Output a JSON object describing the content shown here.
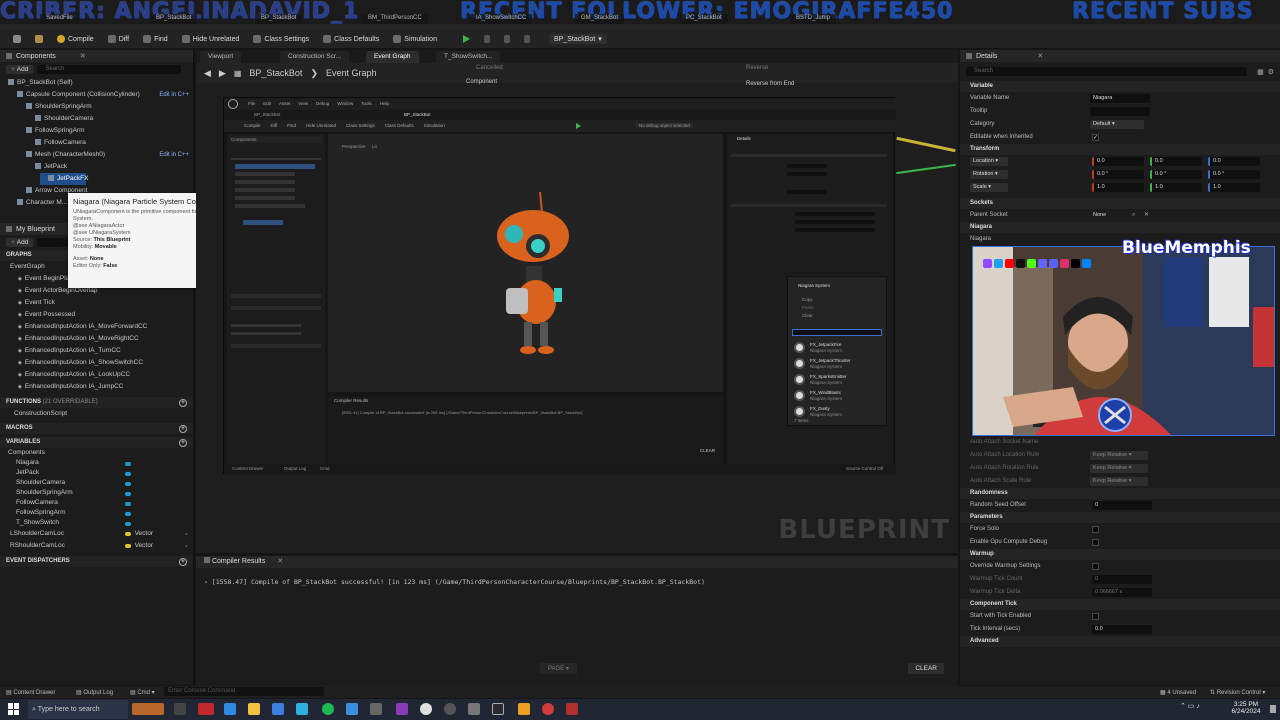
{
  "banner": {
    "left": "CRIBER: ANGELINADAVID_1",
    "middle": "RECENT FOLLOWER: EMOGIRAFFE450",
    "right": "RECENT SUBS"
  },
  "file_tabs": [
    "SavedFile",
    "BP_StackBot",
    "BP_StackBot",
    "BM_ThirdPersonCC",
    "IA_ShowSwitchCC",
    "GM_StackBot",
    "PC_StackBot",
    "BSTD_Jump"
  ],
  "toolbar": {
    "compile": "Compile",
    "diff": "Diff",
    "find": "Find",
    "hide_unrelated": "Hide Unrelated",
    "class_settings": "Class Settings",
    "class_defaults": "Class Defaults",
    "simulation": "Simulation",
    "debug_object": "BP_StackBot"
  },
  "components": {
    "title": "Components",
    "add": "Add",
    "search_placeholder": "Search",
    "items": [
      {
        "label": "BP_StackBot (Self)",
        "indent": 0
      },
      {
        "label": "Capsule Component (CollisionCylinder)",
        "indent": 1,
        "edit": "Edit in C++"
      },
      {
        "label": "ShoulderSpringArm",
        "indent": 2
      },
      {
        "label": "ShoulderCamera",
        "indent": 3
      },
      {
        "label": "FollowSpringArm",
        "indent": 2
      },
      {
        "label": "FollowCamera",
        "indent": 3
      },
      {
        "label": "Mesh (CharacterMesh0)",
        "indent": 2,
        "edit": "Edit in C++"
      },
      {
        "label": "JetPack",
        "indent": 3
      },
      {
        "label": "JetPackFX",
        "indent": 4,
        "selected": true
      },
      {
        "label": "Arrow Component",
        "indent": 2
      },
      {
        "label": "Character M...",
        "indent": 1
      }
    ]
  },
  "tooltip": {
    "title": "Niagara (Niagara Particle System Component)",
    "desc1": "UNiagaraComponent is the primitive component for a Niagara",
    "desc2": "System.",
    "see1": "@see ANiagaraActor",
    "see2": "@see UNiagaraSystem",
    "source_label": "Source:",
    "source_val": "This Blueprint",
    "mobility_label": "Mobility:",
    "mobility_val": "Movable",
    "asset_label": "Asset:",
    "asset_val": "None",
    "editor_only_label": "Editor Only:",
    "editor_only_val": "False"
  },
  "my_blueprint": {
    "title": "My Blueprint",
    "add": "Add",
    "graphs_label": "GRAPHS",
    "event_graph": "EventGraph",
    "events": [
      "Event BeginPlay",
      "Event ActorBeginOverlap",
      "Event Tick",
      "Event Possessed",
      "EnhancedInputAction IA_MoveForwardCC",
      "EnhancedInputAction IA_MoveRightCC",
      "EnhancedInputAction IA_TurnCC",
      "EnhancedInputAction IA_ShowSwitchCC",
      "EnhancedInputAction IA_LookUpCC",
      "EnhancedInputAction IA_JumpCC"
    ],
    "functions_label": "FUNCTIONS",
    "functions_count": "(21 OVERRIDABLE)",
    "construction": "ConstructionScript",
    "macros_label": "MACROS",
    "variables_label": "VARIABLES",
    "components_label": "Components",
    "variables": [
      {
        "name": "Niagara",
        "type": "comp"
      },
      {
        "name": "JetPack",
        "type": "comp"
      },
      {
        "name": "ShoulderCamera",
        "type": "comp"
      },
      {
        "name": "ShoulderSpringArm",
        "type": "comp"
      },
      {
        "name": "FollowCamera",
        "type": "comp"
      },
      {
        "name": "FollowSpringArm",
        "type": "comp"
      },
      {
        "name": "T_ShowSwitch",
        "type": "comp"
      }
    ],
    "vec_vars": [
      {
        "name": "LShoulderCamLoc",
        "type": "Vector"
      },
      {
        "name": "RShoulderCamLoc",
        "type": "Vector"
      }
    ],
    "dispatchers_label": "EVENT DISPATCHERS"
  },
  "center": {
    "tabs": [
      "Viewport",
      "Construction Scr...",
      "Event Graph",
      "T_ShowSwitch..."
    ],
    "active_tab": 2,
    "breadcrumb_root": "BP_StackBot",
    "breadcrumb_leaf": "Event Graph",
    "watermark": "BLUEPRINT",
    "mini_labels": [
      "Reverse",
      "Reverse from End",
      "Component",
      "Cancelled"
    ]
  },
  "inner_editor": {
    "menu": [
      "File",
      "Edit",
      "Asset",
      "View",
      "Debug",
      "Window",
      "Tools",
      "Help"
    ],
    "tabs": [
      "BP_StackBot",
      "BP_StackBot"
    ],
    "toolbar": [
      "Compile",
      "Diff",
      "Find",
      "Hide Unrelated",
      "Class Settings",
      "Class Defaults",
      "Simulation"
    ],
    "debug_filter": "No debug object selected",
    "viewport_tabs": [
      "Components",
      "Viewport",
      "Construction Scr",
      "Event Graph"
    ],
    "perspective": "Perspective",
    "lit": "Lit",
    "details_title": "Details",
    "dropdown_header": "Niagara System",
    "dropdown_items": [
      "Copy",
      "Paste",
      "Clear"
    ],
    "assets": [
      {
        "name": "FX_JetpackFire",
        "type": "Niagara System"
      },
      {
        "name": "FX_JetpackThruster",
        "type": "Niagara System"
      },
      {
        "name": "FX_SparksEmitter",
        "type": "Niagara System"
      },
      {
        "name": "FX_WindBlasts",
        "type": "Niagara System"
      },
      {
        "name": "FX_Dusty",
        "type": "Niagara System"
      }
    ],
    "items_count": "7 items",
    "compile_msg": "[5591.41] Compile of BP_StackBot successful! [in 265 ms] (/Game/ThirdPersonCharacterCourse/Blueprints/BP_StackBot.BP_StackBot)",
    "compiler_title": "Compiler Results",
    "clear": "CLEAR",
    "content_drawer": "Content Drawer",
    "output_log": "Output Log",
    "cmd": "Cmd",
    "source_control": "Source Control Off"
  },
  "compiler": {
    "title": "Compiler Results",
    "message": "[1558.47] Compile of BP_StackBot successful! [in 123 ms] (/Game/ThirdPersonCharacterCourse/Blueprints/BP_StackBot.BP_StackBot)",
    "page": "PAGE",
    "clear": "CLEAR"
  },
  "details": {
    "title": "Details",
    "search_placeholder": "Search",
    "variable_label": "Variable",
    "variable_name_label": "Variable Name",
    "variable_name_value": "Niagara",
    "tooltip_label": "Tooltip",
    "category_label": "Category",
    "category_value": "Default",
    "editable_label": "Editable when Inherited",
    "transform_label": "Transform",
    "location_label": "Location",
    "rotation_label": "Rotation",
    "scale_label": "Scale",
    "loc_vals": [
      "0.0",
      "0.0",
      "0.0"
    ],
    "rot_vals": [
      "0.0 °",
      "0.0 °",
      "0.0 °"
    ],
    "scale_vals": [
      "1.0",
      "1.0",
      "1.0"
    ],
    "sockets_label": "Sockets",
    "parent_socket_label": "Parent Socket",
    "parent_socket_value": "None",
    "niagara_label": "Niagara",
    "niagara_row": "Niagara",
    "aa_socket_name": "Auto Attach Socket Name",
    "aa_location_rule": "Auto Attach Location Rule",
    "aa_rotation_rule": "Auto Attach Rotation Rule",
    "aa_scale_rule": "Auto Attach Scale Rule",
    "keep_relative": "Keep Relative",
    "randomness_label": "Randomness",
    "random_seed_label": "Random Seed Offset",
    "random_seed_value": "0",
    "parameters_label": "Parameters",
    "force_solo": "Force Solo",
    "gpu_debug": "Enable Gpu Compute Debug",
    "warmup_label": "Warmup",
    "override_warmup": "Override Warmup Settings",
    "warmup_tick_count": "Warmup Tick Count",
    "warmup_tick_count_val": "0",
    "warmup_tick_delta": "Warmup Tick Delta",
    "warmup_tick_delta_val": "0.066667 s",
    "component_tick_label": "Component Tick",
    "start_with_tick": "Start with Tick Enabled",
    "tick_interval": "Tick Interval (secs)",
    "tick_interval_val": "0.0",
    "advanced_label": "Advanced"
  },
  "webcam": {
    "title": "BlueMemphis"
  },
  "statusbar": {
    "content_drawer": "Content Drawer",
    "output_log": "Output Log",
    "cmd": "Cmd",
    "console_placeholder": "Enter Console Command",
    "unsaved": "4 Unsaved",
    "revision": "Revision Control"
  },
  "taskbar": {
    "search_placeholder": "Type here to search",
    "time": "3:25 PM",
    "date": "6/24/2024"
  },
  "colors": {
    "accent": "#1f4e8a",
    "banner_blue": "#1c4aa8",
    "pin_blue": "#1e9bd7",
    "pin_yellow": "#e6c229",
    "play_green": "#3ab54a"
  }
}
